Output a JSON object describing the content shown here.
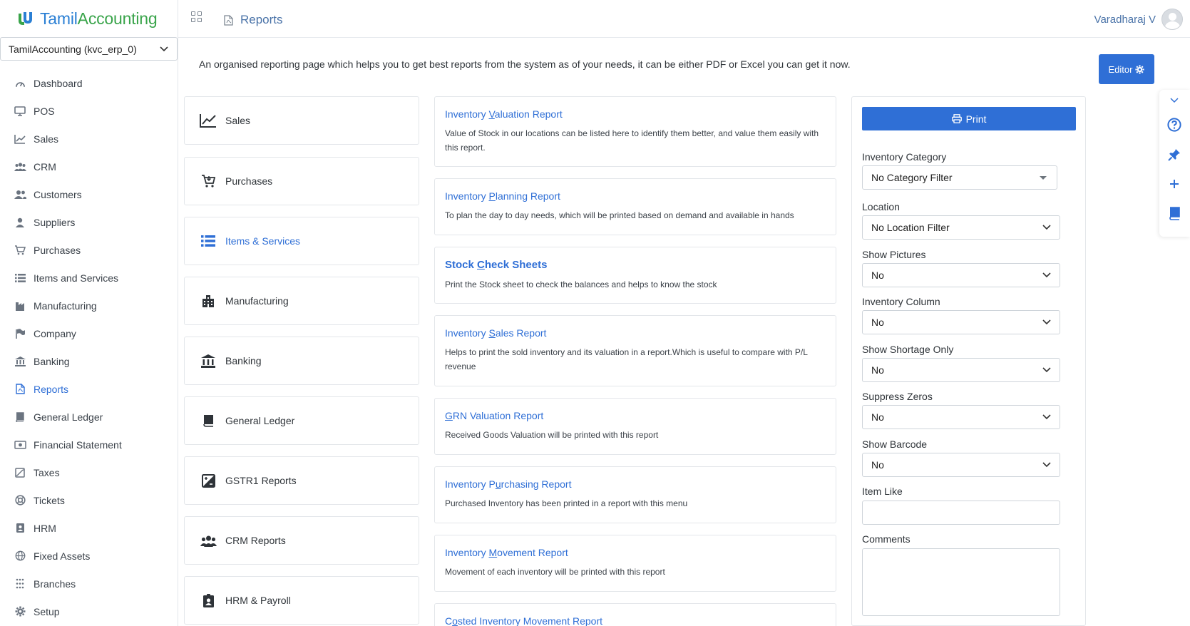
{
  "app": {
    "logo_part1": "Tamil",
    "logo_part2": "Accounting",
    "company": "TamilAccounting (kvc_erp_0)"
  },
  "sidebar": {
    "items": [
      {
        "label": "Dashboard",
        "icon": "dashboard-icon"
      },
      {
        "label": "POS",
        "icon": "monitor-icon"
      },
      {
        "label": "Sales",
        "icon": "chart-line-icon"
      },
      {
        "label": "CRM",
        "icon": "users-icon"
      },
      {
        "label": "Customers",
        "icon": "user-friends-icon"
      },
      {
        "label": "Suppliers",
        "icon": "user-icon"
      },
      {
        "label": "Purchases",
        "icon": "cart-icon"
      },
      {
        "label": "Items and Services",
        "icon": "list-icon"
      },
      {
        "label": "Manufacturing",
        "icon": "industry-icon"
      },
      {
        "label": "Company",
        "icon": "flag-icon"
      },
      {
        "label": "Banking",
        "icon": "bank-icon"
      },
      {
        "label": "Reports",
        "icon": "file-pdf-icon"
      },
      {
        "label": "General Ledger",
        "icon": "book-icon"
      },
      {
        "label": "Financial Statement",
        "icon": "money-icon"
      },
      {
        "label": "Taxes",
        "icon": "tax-icon"
      },
      {
        "label": "Tickets",
        "icon": "lifebuoy-icon"
      },
      {
        "label": "HRM",
        "icon": "id-badge-icon"
      },
      {
        "label": "Fixed Assets",
        "icon": "globe-icon"
      },
      {
        "label": "Branches",
        "icon": "dots-grid-icon"
      },
      {
        "label": "Setup",
        "icon": "gear-icon"
      }
    ],
    "active": "Reports"
  },
  "header": {
    "breadcrumb": "Reports",
    "user_name": "Varadharaj V"
  },
  "intro_text": "An organised reporting page which helps you to get best reports from the system as of your needs, it can be either PDF or Excel you can get it now.",
  "editor_label": "Editor",
  "categories": [
    {
      "label": "Sales",
      "icon": "chart-line-icon"
    },
    {
      "label": "Purchases",
      "icon": "cart-icon"
    },
    {
      "label": "Items & Services",
      "icon": "list-icon"
    },
    {
      "label": "Manufacturing",
      "icon": "industry-icon"
    },
    {
      "label": "Banking",
      "icon": "bank-icon"
    },
    {
      "label": "General Ledger",
      "icon": "book-icon"
    },
    {
      "label": "GSTR1 Reports",
      "icon": "tax-icon"
    },
    {
      "label": "CRM Reports",
      "icon": "users-icon"
    },
    {
      "label": "HRM & Payroll",
      "icon": "id-badge-icon"
    }
  ],
  "active_category": "Items & Services",
  "reports": [
    {
      "pre": "Inventory ",
      "u": "V",
      "post": "aluation Report",
      "desc": "Value of Stock in our locations can be listed here to identify them better, and value them easily with this report."
    },
    {
      "pre": "Inventory ",
      "u": "P",
      "post": "lanning Report",
      "desc": "To plan the day to day needs, which will be printed based on demand and available in hands"
    },
    {
      "pre": "Stock ",
      "u": "C",
      "post": "heck Sheets",
      "desc": "Print the Stock sheet to check the balances and helps to know the stock"
    },
    {
      "pre": "Inventory ",
      "u": "S",
      "post": "ales Report",
      "desc": "Helps to print the sold inventory and its valuation in a report.Which is useful to compare with P/L revenue"
    },
    {
      "pre": "",
      "u": "G",
      "post": "RN Valuation Report",
      "desc": "Received Goods Valuation will be printed with this report"
    },
    {
      "pre": "Inventory P",
      "u": "u",
      "post": "rchasing Report",
      "desc": "Purchased Inventory has been printed in a report with this menu"
    },
    {
      "pre": "Inventory ",
      "u": "M",
      "post": "ovement Report",
      "desc": "Movement of each inventory will be printed with this report"
    },
    {
      "pre": "C",
      "u": "o",
      "post": "sted Inventory Movement Report",
      "desc": ""
    }
  ],
  "filters": {
    "print_label": "Print",
    "inventory_category": {
      "label": "Inventory Category",
      "value": "No Category Filter"
    },
    "location": {
      "label": "Location",
      "value": "No Location Filter"
    },
    "show_pictures": {
      "label": "Show Pictures",
      "value": "No"
    },
    "inventory_column": {
      "label": "Inventory Column",
      "value": "No"
    },
    "show_shortage": {
      "label": "Show Shortage Only",
      "value": "No"
    },
    "suppress_zeros": {
      "label": "Suppress Zeros",
      "value": "No"
    },
    "show_barcode": {
      "label": "Show Barcode",
      "value": "No"
    },
    "item_like": {
      "label": "Item Like",
      "value": ""
    },
    "comments": {
      "label": "Comments",
      "value": ""
    }
  },
  "colors": {
    "accent": "#2f6fd6",
    "logo_blue": "#2a7fd4",
    "logo_green": "#39a44a"
  }
}
